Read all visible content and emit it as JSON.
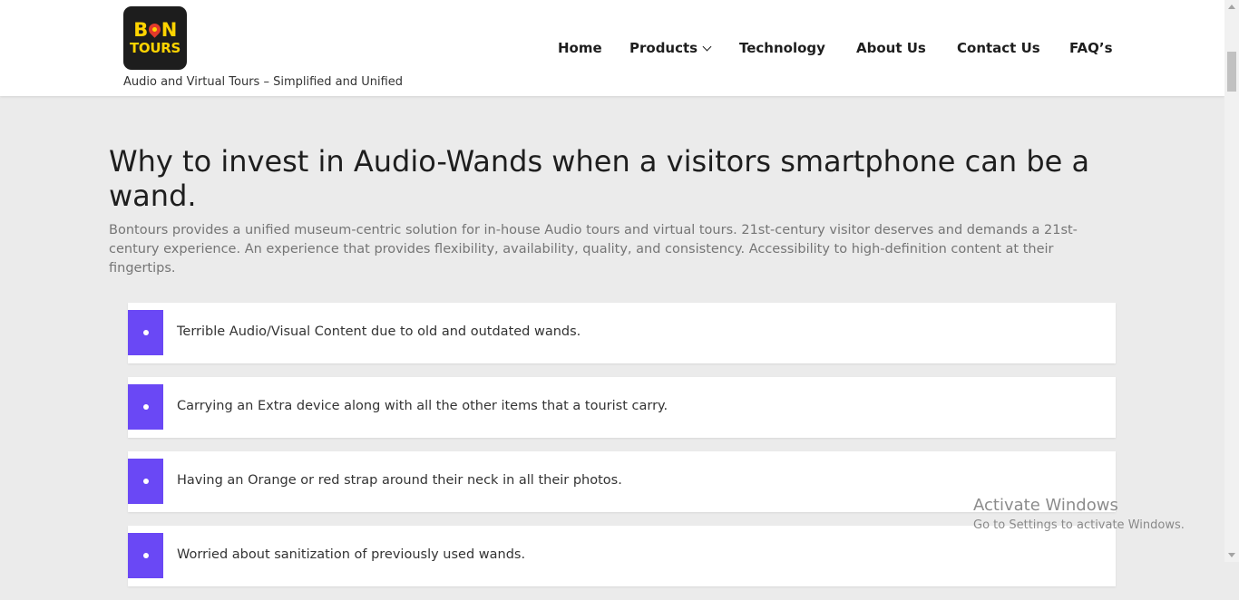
{
  "header": {
    "logo": {
      "line1_left": "B",
      "line1_right": "N",
      "line2": "TOURS",
      "pin_icon": "map-pin-icon"
    },
    "tagline": "Audio and Virtual Tours – Simplified and Unified",
    "nav": [
      {
        "label": "Home"
      },
      {
        "label": "Products",
        "icon": "chevron-down-icon"
      },
      {
        "label": "Technology"
      },
      {
        "label": "About Us"
      },
      {
        "label": "Contact Us"
      },
      {
        "label": "FAQ’s"
      }
    ]
  },
  "main": {
    "headline": "Why to invest in Audio-Wands when a visitors smartphone can be a wand.",
    "intro": "Bontours provides a unified museum-centric solution for in-house Audio tours and virtual tours. 21st-century visitor deserves and demands a 21st-century experience. An experience that provides flexibility, availability, quality, and consistency. Accessibility to high-definition content at their fingertips.",
    "items": [
      {
        "text": "Terrible Audio/Visual Content due to old and outdated wands."
      },
      {
        "text": "Carrying an Extra device along with all the other items that a tourist carry."
      },
      {
        "text": "Having an Orange or red strap around their neck in all their photos."
      },
      {
        "text": "Worried about sanitization of previously used wands."
      }
    ]
  },
  "watermark": {
    "title": "Activate Windows",
    "subtitle": "Go to Settings to activate Windows."
  },
  "colors": {
    "accent": "#6a48f5",
    "logo_bg": "#1d1d1d",
    "logo_text": "#ffd400",
    "pin": "#e23a2b",
    "page_bg": "#ebebeb"
  }
}
